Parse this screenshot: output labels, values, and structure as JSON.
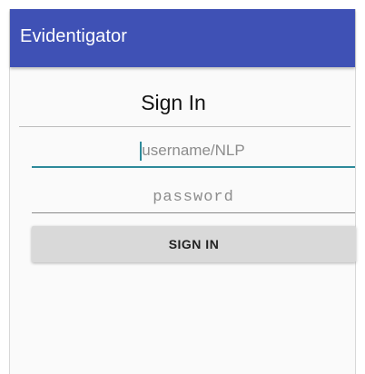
{
  "app_bar": {
    "title": "Evidentigator",
    "color": "#3f51b5"
  },
  "form": {
    "heading": "Sign In",
    "username": {
      "value": "",
      "placeholder": "username/NLP",
      "focused": true,
      "accent_color": "#2e8a9a"
    },
    "password": {
      "value": "",
      "placeholder": "password"
    },
    "submit_label": "SIGN IN"
  }
}
